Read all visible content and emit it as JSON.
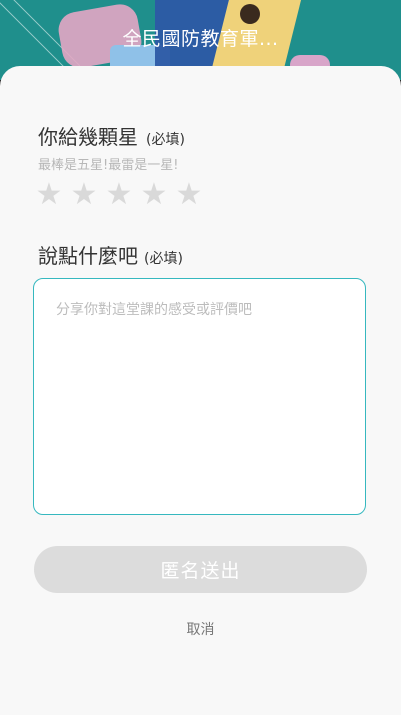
{
  "header": {
    "title": "全民國防教育軍..."
  },
  "rating": {
    "question": "你給幾顆星",
    "required": "(必填)",
    "hint": "最棒是五星!最雷是一星!",
    "star_glyph": "★",
    "max_stars": 5,
    "selected_stars": 0
  },
  "comment": {
    "question": "說點什麼吧",
    "required": "(必填)",
    "placeholder": "分享你對這堂課的感受或評價吧",
    "value": ""
  },
  "actions": {
    "submit_label": "匿名送出",
    "cancel_label": "取消"
  },
  "colors": {
    "accent": "#36b8bf",
    "header_bg": "#1f8f8c",
    "disabled_button": "#dcdcdc",
    "star_empty": "#d9d9d9"
  }
}
